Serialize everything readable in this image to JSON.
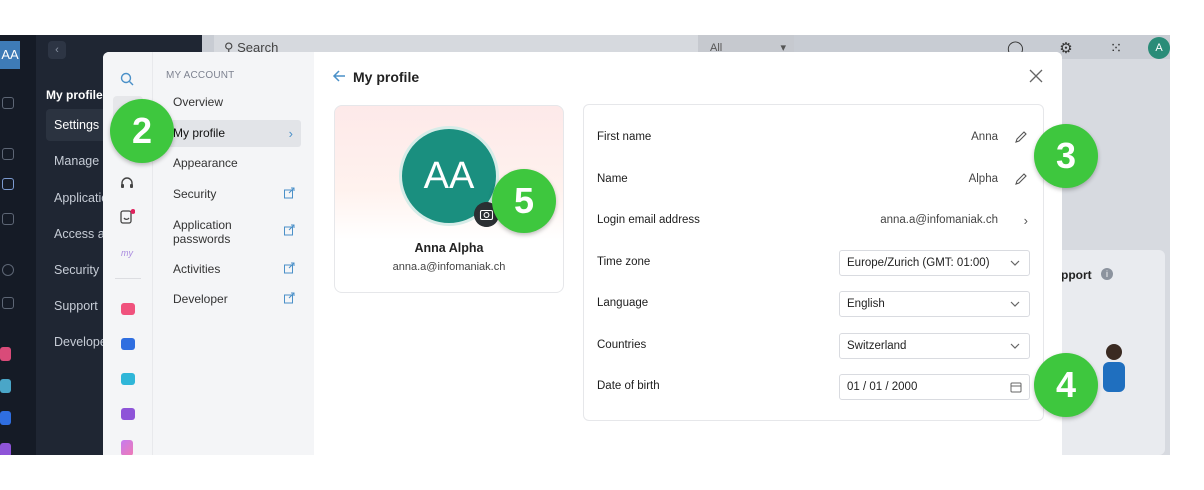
{
  "background_app": {
    "user_initials": "AA",
    "sidebar": {
      "title": "My profile",
      "items": [
        "Settings",
        "Manage p",
        "Applicatio",
        "Access ar",
        "Security",
        "Support",
        "Develope"
      ]
    },
    "search_placeholder": "Search",
    "search_scope": "All",
    "top_avatar": "A",
    "support_card_title": "pport",
    "info_glyph": "i"
  },
  "modal": {
    "nav": {
      "section_label": "MY ACCOUNT",
      "items": [
        {
          "label": "Overview"
        },
        {
          "label": "My profile"
        },
        {
          "label": "Appearance"
        },
        {
          "label": "Security"
        },
        {
          "label": "Application passwords"
        },
        {
          "label": "Activities"
        },
        {
          "label": "Developer"
        }
      ]
    },
    "page_title": "My profile",
    "profile": {
      "initials": "AA",
      "full_name": "Anna Alpha",
      "email": "anna.a@infomaniak.ch"
    },
    "form": {
      "first_name": {
        "label": "First name",
        "value": "Anna"
      },
      "name": {
        "label": "Name",
        "value": "Alpha"
      },
      "login_email": {
        "label": "Login email address",
        "value": "anna.a@infomaniak.ch"
      },
      "time_zone": {
        "label": "Time zone",
        "value": "Europe/Zurich (GMT: 01:00)"
      },
      "language": {
        "label": "Language",
        "value": "English"
      },
      "countries": {
        "label": "Countries",
        "value": "Switzerland"
      },
      "date_of_birth": {
        "label": "Date of birth",
        "value": "01 / 01 / 2000"
      }
    }
  },
  "annotations": {
    "badge_2": "2",
    "badge_3": "3",
    "badge_4": "4",
    "badge_5": "5"
  },
  "colors": {
    "badge_green": "#3ec73e",
    "avatar_teal": "#1a8f7f",
    "accent_blue": "#4a90c8",
    "notification_red": "#e0245e"
  }
}
